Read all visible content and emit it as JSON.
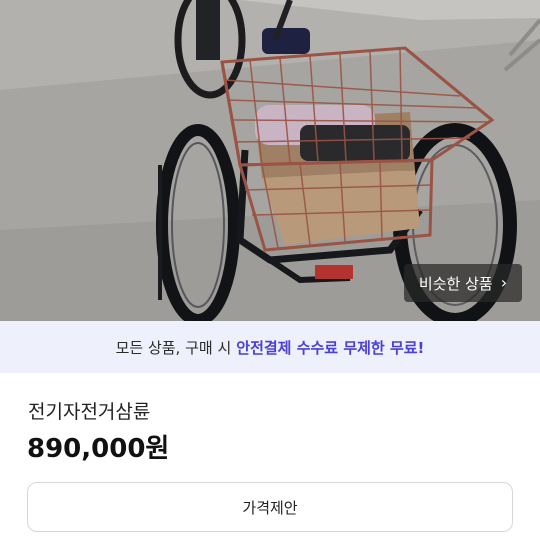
{
  "product_image": {
    "alt": "전기자전거삼륜",
    "similar_button_label": "비슷한 상품",
    "similar_button_icon": "chevron-right-icon"
  },
  "banner": {
    "text": "모든 상품, 구매 시",
    "highlight": "안전결제 수수료 무제한 무료!",
    "background": "#eef0fb",
    "highlight_color": "#4a3fd6"
  },
  "product": {
    "title": "전기자전거삼륜",
    "price": "890,000원"
  },
  "actions": {
    "offer_label": "가격제안"
  }
}
